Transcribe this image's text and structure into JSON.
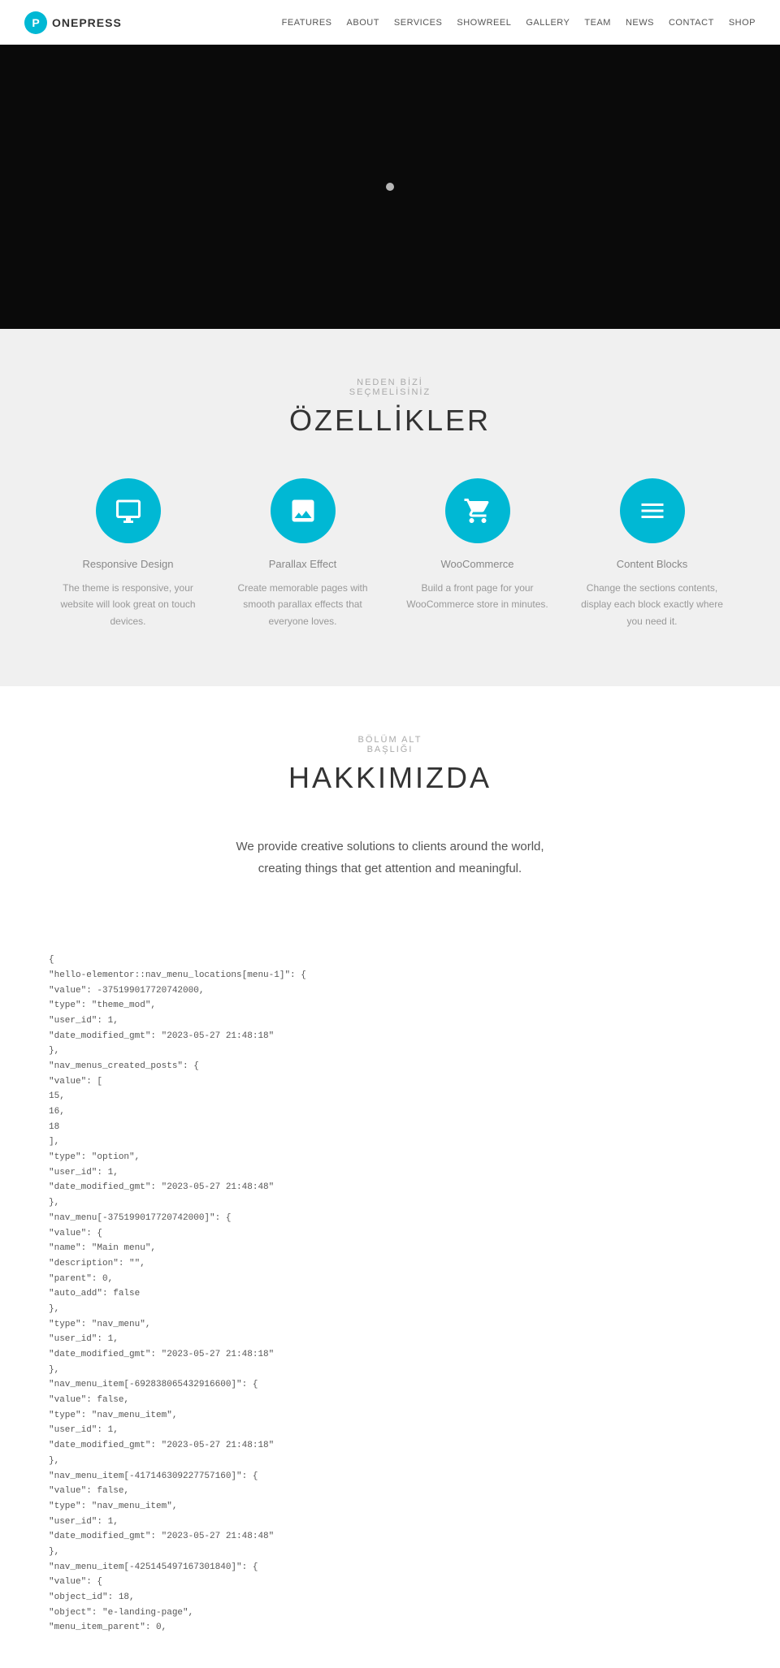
{
  "header": {
    "logo_icon": "P",
    "logo_text": "ONEPRESS",
    "nav_items": [
      {
        "label": "FEATURES",
        "href": "#features"
      },
      {
        "label": "ABOUT",
        "href": "#about"
      },
      {
        "label": "SERVICES",
        "href": "#services"
      },
      {
        "label": "SHOWREEL",
        "href": "#showreel"
      },
      {
        "label": "GALLERY",
        "href": "#gallery"
      },
      {
        "label": "TEAM",
        "href": "#team"
      },
      {
        "label": "NEWS",
        "href": "#news"
      },
      {
        "label": "CONTACT",
        "href": "#contact"
      },
      {
        "label": "SHOP",
        "href": "#shop"
      }
    ]
  },
  "features_section": {
    "subtitle": "NEDEN BİZİ\nSEÇMELİSİNİZ",
    "title": "ÖZELLİKLER",
    "items": [
      {
        "title": "Responsive Design",
        "desc": "The theme is responsive, your website will look great on touch devices.",
        "icon": "monitor"
      },
      {
        "title": "Parallax Effect",
        "desc": "Create memorable pages with smooth parallax effects that everyone loves.",
        "icon": "image"
      },
      {
        "title": "WooCommerce",
        "desc": "Build a front page for your WooCommerce store in minutes.",
        "icon": "cart"
      },
      {
        "title": "Content Blocks",
        "desc": "Change the sections contents, display each block exactly where you need it.",
        "icon": "menu"
      }
    ]
  },
  "about_section": {
    "subtitle": "BÖLÜM ALT\nBAŞLIĞI",
    "title": "HAKKIMIZDA",
    "desc_line1": "We provide creative solutions to clients around the world,",
    "desc_line2": "creating things that get attention and meaningful."
  },
  "json_data": "{\n\"hello-elementor::nav_menu_locations[menu-1]\": {\n\"value\": -375199017720742000,\n\"type\": \"theme_mod\",\n\"user_id\": 1,\n\"date_modified_gmt\": \"2023-05-27 21:48:18\"\n},\n\"nav_menus_created_posts\": {\n\"value\": [\n15,\n16,\n18\n],\n\"type\": \"option\",\n\"user_id\": 1,\n\"date_modified_gmt\": \"2023-05-27 21:48:48\"\n},\n\"nav_menu[-375199017720742000]\": {\n\"value\": {\n\"name\": \"Main menu\",\n\"description\": \"\",\n\"parent\": 0,\n\"auto_add\": false\n},\n\"type\": \"nav_menu\",\n\"user_id\": 1,\n\"date_modified_gmt\": \"2023-05-27 21:48:18\"\n},\n\"nav_menu_item[-692838065432916600]\": {\n\"value\": false,\n\"type\": \"nav_menu_item\",\n\"user_id\": 1,\n\"date_modified_gmt\": \"2023-05-27 21:48:18\"\n},\n\"nav_menu_item[-417146309227757160]\": {\n\"value\": false,\n\"type\": \"nav_menu_item\",\n\"user_id\": 1,\n\"date_modified_gmt\": \"2023-05-27 21:48:48\"\n},\n\"nav_menu_item[-425145497167301840]\": {\n\"value\": {\n\"object_id\": 18,\n\"object\": \"e-landing-page\",\n\"menu_item_parent\": 0,"
}
